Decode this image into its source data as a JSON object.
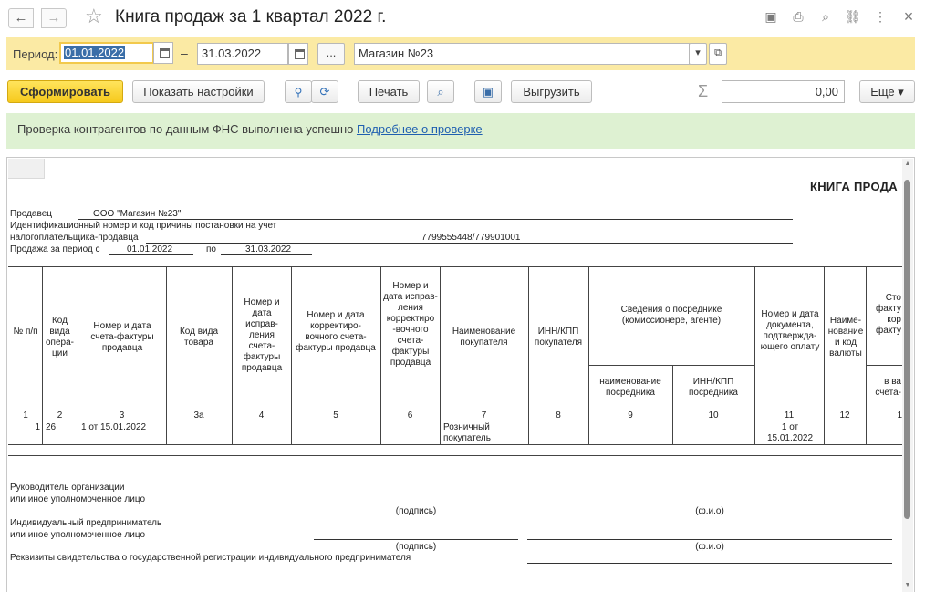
{
  "window": {
    "title": "Книга продаж за 1 квартал 2022 г.",
    "nav_back": "←",
    "nav_forward": "→",
    "star": "☆",
    "icons": [
      "save-icon",
      "print-icon",
      "preview-icon",
      "link-icon",
      "more-icon",
      "close-icon"
    ],
    "icon_glyphs": {
      "save": "▣",
      "print": "⎙",
      "preview": "⌕",
      "link": "⛓",
      "more": "⋮",
      "close": "×"
    }
  },
  "period": {
    "label": "Период:",
    "from": "01.01.2022",
    "dash": "–",
    "to": "31.03.2022",
    "ellipsis": "...",
    "org": "Магазин №23",
    "dropdown_glyph": "▾",
    "open_glyph": "⧉"
  },
  "toolbar": {
    "generate": "Сформировать",
    "show_settings": "Показать настройки",
    "search_glyph": "🔍",
    "search_next_glyph": "⟳",
    "print": "Печать",
    "preview_glyph": "⌕",
    "save_glyph": "▣",
    "export": "Выгрузить",
    "sum_sign": "Σ",
    "sum_value": "0,00",
    "more": "Еще ▾"
  },
  "banner": {
    "text": "Проверка контрагентов по данным ФНС выполнена успешно",
    "link": "Подробнее о проверке"
  },
  "report": {
    "title": "КНИГА ПРОДА",
    "seller_label": "Продавец",
    "seller_value": "ООО \"Магазин №23\"",
    "inn_label_1": "Идентификационный номер и код причины постановки на учет",
    "inn_label_2": "налогоплательщика-продавца",
    "inn_value": "7799555448/779901001",
    "period_label": "Продажа за период с",
    "period_from": "01.01.2022",
    "period_to_label": "по",
    "period_to": "31.03.2022",
    "headers": {
      "c1": "№ п/п",
      "c2": "Код вида опера-ции",
      "c3": "Номер и дата счета-фактуры продавца",
      "c4": "Код вида товара",
      "c5": "Номер и дата исправ-ления счета-фактуры продавца",
      "c6": "Номер и дата корректиро-вочного счета-фактуры продавца",
      "c7": "Номер и дата исправ-ления корректиро -вочного счета-фактуры продавца",
      "c8": "Наименование покупателя",
      "c9": "ИНН/КПП покупателя",
      "c10_group": "Сведения о посреднике (комиссионере, агенте)",
      "c10a": "наименование посредника",
      "c10b": "ИНН/КПП посредника",
      "c11": "Номер и дата документа, подтвержда-ющего оплату",
      "c12": "Наиме-нование и код валюты",
      "c13_top": "Сто факту кор факту",
      "c13_bottom": "в ва счета-"
    },
    "col_numbers": [
      "1",
      "2",
      "3",
      "3а",
      "4",
      "5",
      "6",
      "7",
      "8",
      "9",
      "10",
      "11",
      "12",
      "1"
    ],
    "row": {
      "n": "1",
      "op_code": "26",
      "invoice": "1 от 15.01.2022",
      "buyer": "Розничный покупатель",
      "payment_doc": "1 от 15.01.2022"
    },
    "signatures": {
      "head_1": "Руководитель организации",
      "head_2": "или иное уполномоченное лицо",
      "ip_1": "Индивидуальный предприниматель",
      "ip_2": "или иное уполномоченное лицо",
      "cap_sign": "(подпись)",
      "cap_name": "(ф.и.о)",
      "requisites": "Реквизиты свидетельства о государственной регистрации индивидуального предпринимателя"
    }
  }
}
